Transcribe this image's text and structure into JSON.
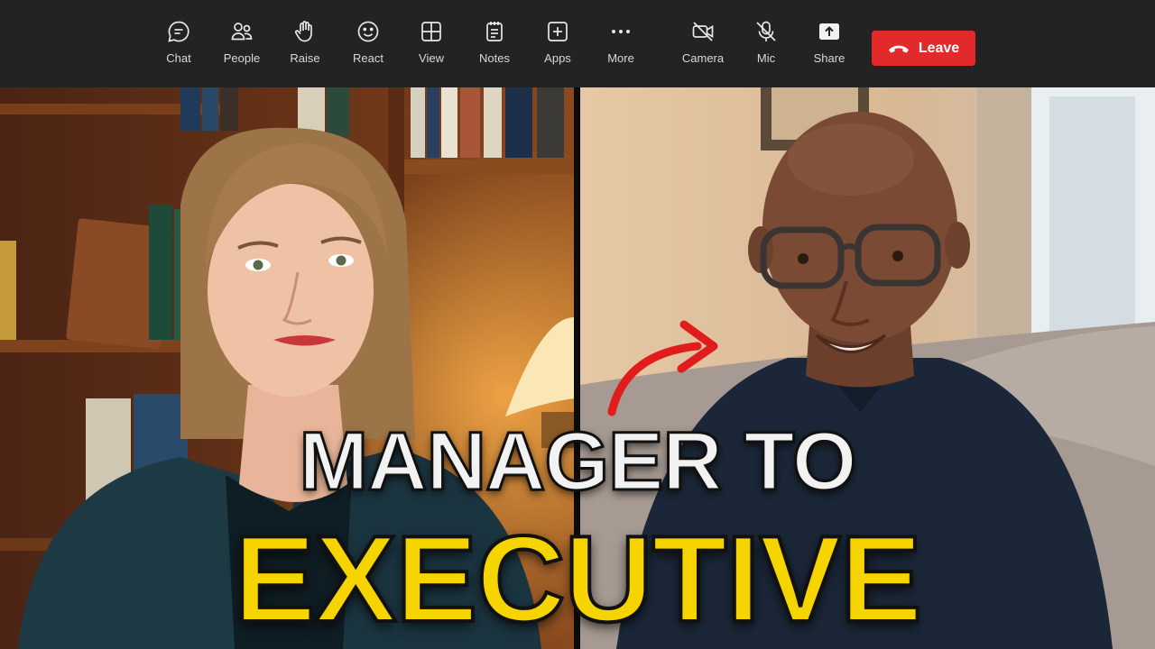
{
  "toolbar": {
    "buttons": [
      {
        "label": "Chat",
        "icon": "chat-icon"
      },
      {
        "label": "People",
        "icon": "people-icon"
      },
      {
        "label": "Raise",
        "icon": "raise-hand-icon"
      },
      {
        "label": "React",
        "icon": "smiley-icon"
      },
      {
        "label": "View",
        "icon": "grid-view-icon"
      },
      {
        "label": "Notes",
        "icon": "notes-icon"
      },
      {
        "label": "Apps",
        "icon": "apps-plus-icon"
      },
      {
        "label": "More",
        "icon": "more-dots-icon"
      },
      {
        "label": "Camera",
        "icon": "camera-off-icon"
      },
      {
        "label": "Mic",
        "icon": "mic-off-icon"
      },
      {
        "label": "Share",
        "icon": "share-tray-icon"
      }
    ],
    "leave": {
      "label": "Leave",
      "icon": "hang-up-phone-icon",
      "color": "#e32a2a"
    }
  },
  "headline": {
    "line1": "MANAGER TO",
    "line2": "EXECUTIVE",
    "line1_color": "#f2f2f2",
    "line2_color": "#f6d400"
  },
  "participants": [
    {
      "tile": "left",
      "description_icon": "participant-video-woman"
    },
    {
      "tile": "right",
      "description_icon": "participant-video-man"
    }
  ],
  "annotation": {
    "icon": "curved-arrow-icon",
    "color": "#e01c1c"
  }
}
